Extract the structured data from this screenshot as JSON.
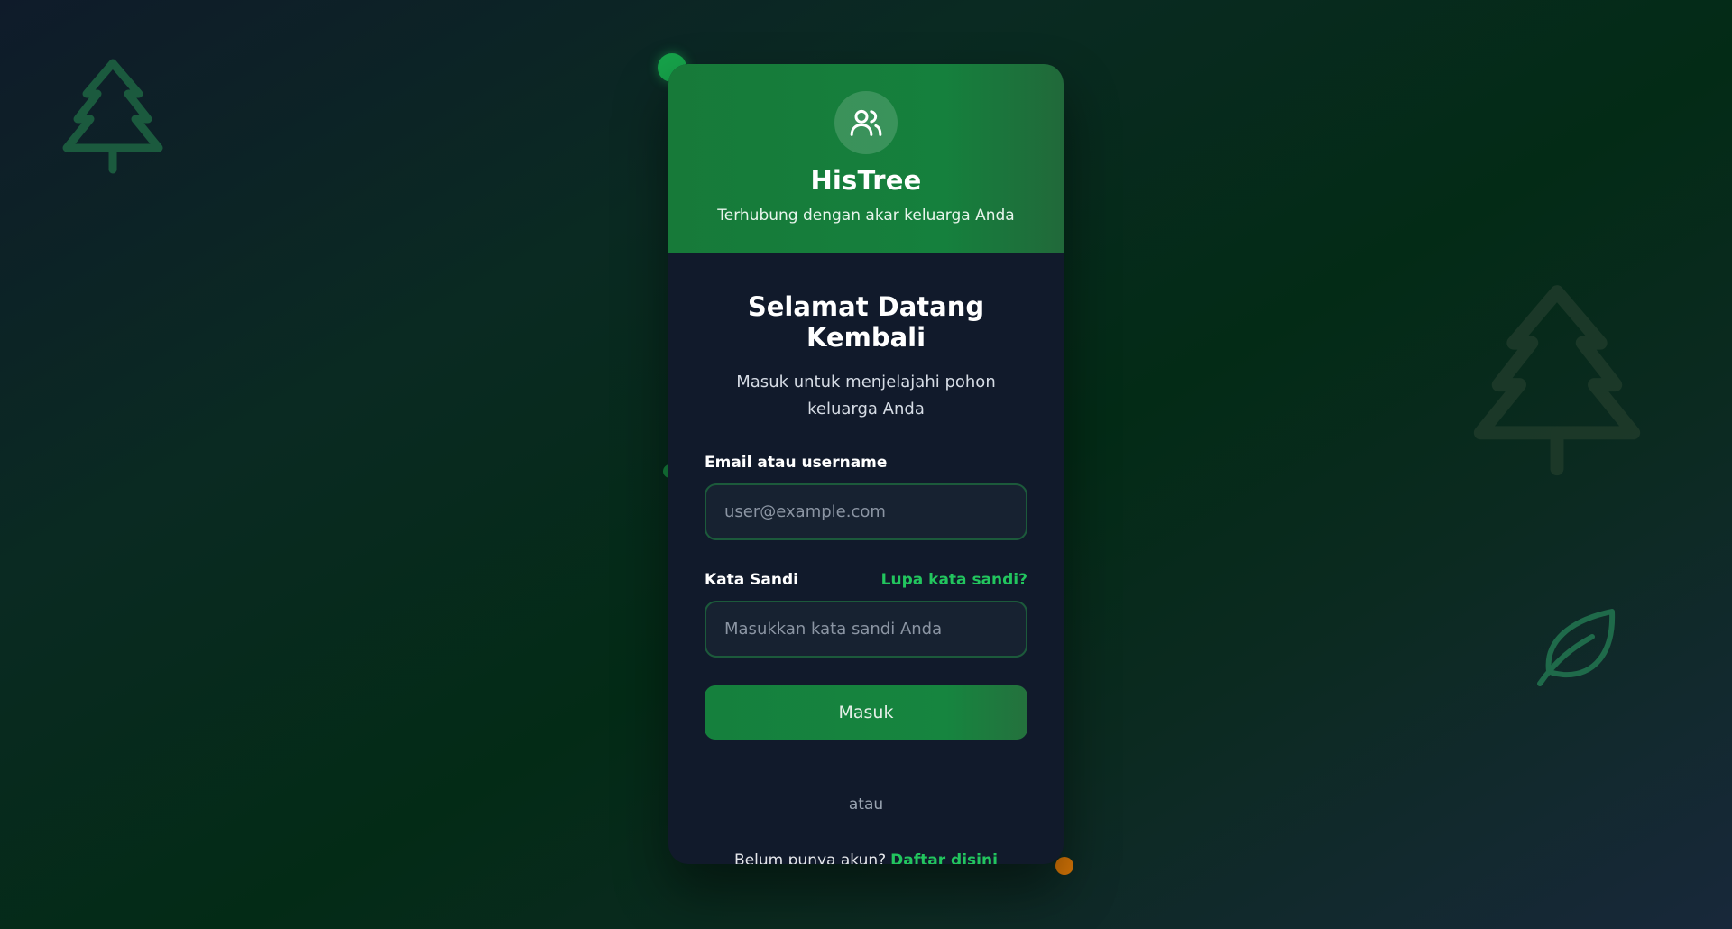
{
  "brand": {
    "name": "HisTree",
    "tagline": "Terhubung dengan akar keluarga Anda",
    "icon": "users-icon"
  },
  "login": {
    "title": "Selamat Datang Kembali",
    "subtitle": "Masuk untuk menjelajahi pohon keluarga Anda",
    "email_label": "Email atau username",
    "email_placeholder": "user@example.com",
    "email_value": "",
    "password_label": "Kata Sandi",
    "forgot_link": "Lupa kata sandi?",
    "password_placeholder": "Masukkan kata sandi Anda",
    "password_value": "",
    "submit_label": "Masuk",
    "divider_text": "atau",
    "signup_prompt": "Belum punya akun?",
    "signup_link": "Daftar disini"
  },
  "decorations": {
    "icons": [
      "tree-icon",
      "tree-icon",
      "leaf-icon"
    ]
  },
  "colors": {
    "accent": "#15803d",
    "link": "#22c55e",
    "card_bg": "#111a2b",
    "amber_dot": "#d97706"
  }
}
